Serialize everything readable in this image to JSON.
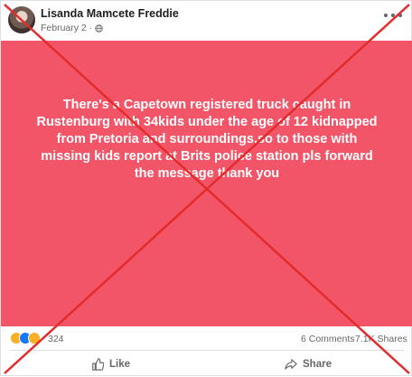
{
  "post": {
    "author": "Lisanda Mamcete Freddie",
    "date": "February 2",
    "privacy_icon": "globe-icon",
    "message": "There's a Capetown registered truck caught in Rustenburg with 34kids under the age of 12 kidnapped from Pretoria and surroundings,so to those with missing kids report at Brits police station pls forward the message thank you",
    "background_color": "#f35568"
  },
  "engagement": {
    "reaction_count": "324",
    "comments": "6 Comments",
    "shares": "7.1K Shares"
  },
  "actions": {
    "like_label": "Like",
    "share_label": "Share"
  },
  "overlay": {
    "type": "red-cross",
    "color": "#e32b2b"
  }
}
